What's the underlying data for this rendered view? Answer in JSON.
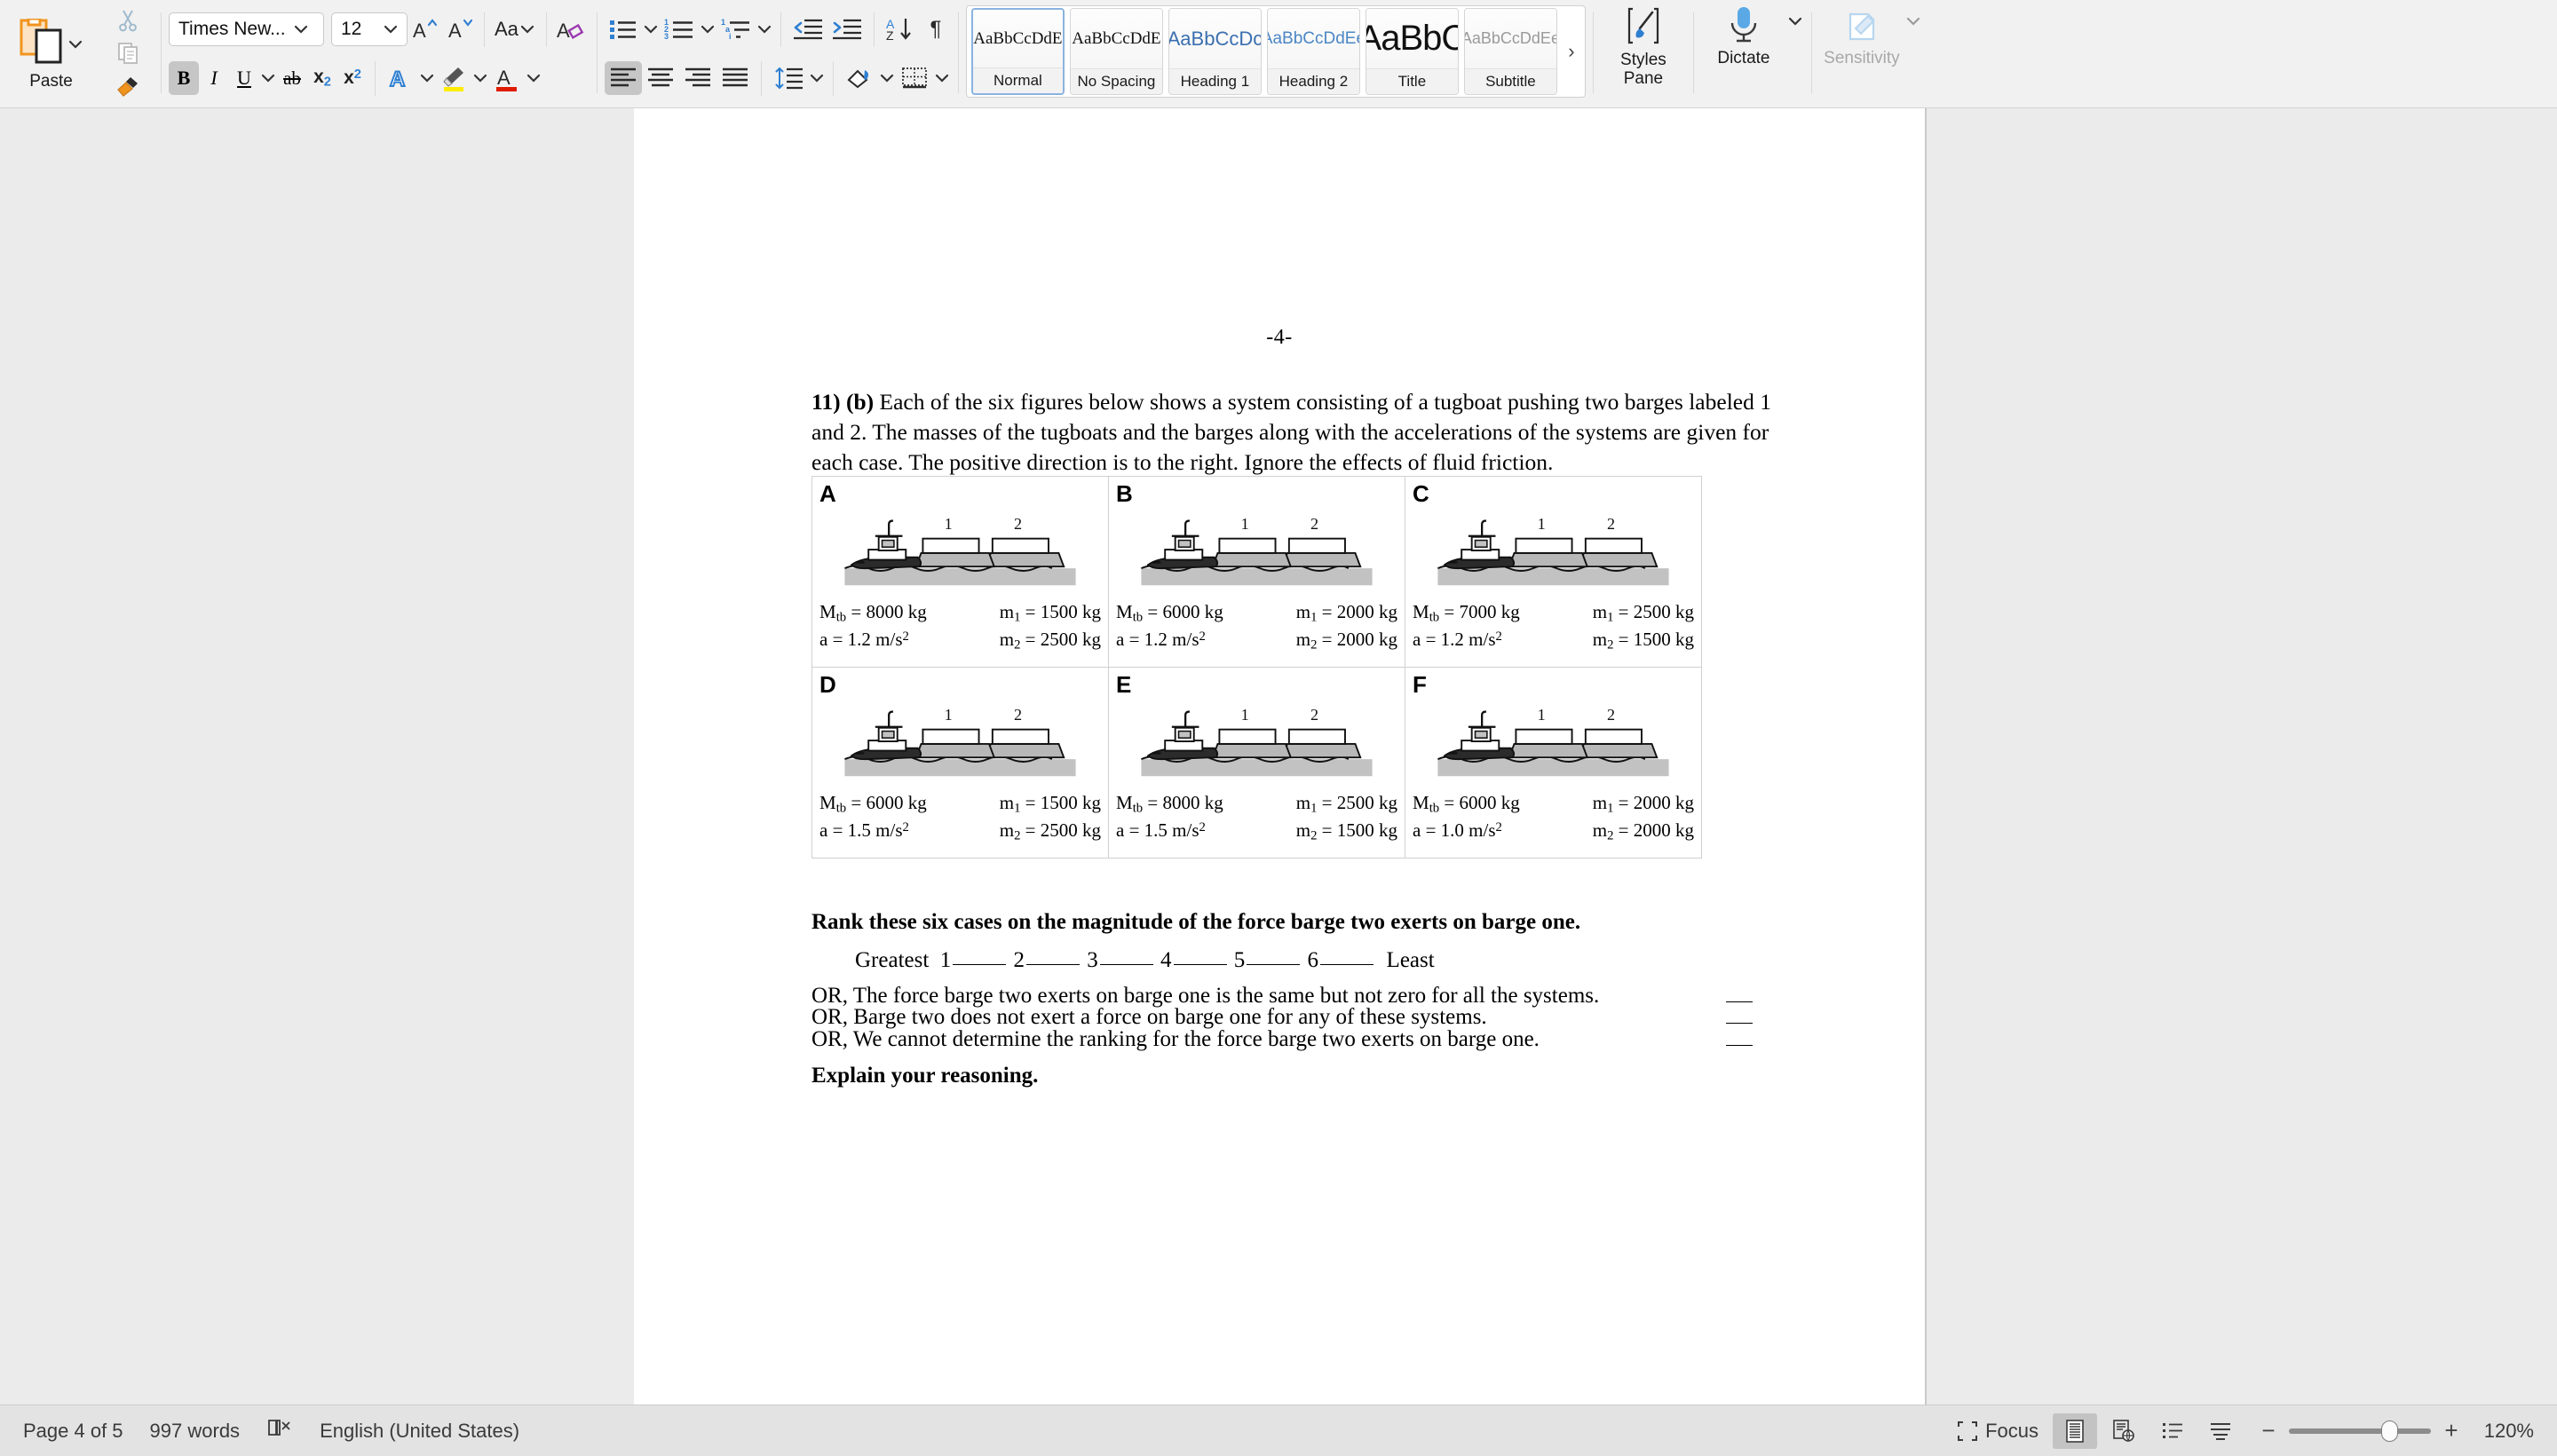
{
  "ribbon": {
    "paste": {
      "label": "Paste",
      "icon": "clipboard-icon"
    },
    "cut_icon": "scissors-icon",
    "copy_icon": "copy-icon",
    "format_painter_icon": "format-painter-icon",
    "font_name": "Times New...",
    "font_size": "12",
    "grow_font_icon": "grow-font-icon",
    "shrink_font_icon": "shrink-font-icon",
    "change_case_label": "Aa",
    "clear_formatting_icon": "clear-formatting-icon",
    "bold_label": "B",
    "italic_label": "I",
    "underline_label": "U",
    "strikethrough_label": "ab",
    "subscript_label": "x",
    "subscript_sub": "2",
    "superscript_label": "x",
    "superscript_sup": "2",
    "text_effects_label": "A",
    "highlight_label": "A",
    "font_color_label": "A",
    "bullets_icon": "bullet-list-icon",
    "numbering_icon": "numbered-list-icon",
    "multilevel_icon": "multilevel-list-icon",
    "decrease_indent_icon": "decrease-indent-icon",
    "increase_indent_icon": "increase-indent-icon",
    "sort_icon": "sort-az-icon",
    "show_marks_label": "¶",
    "align_left_icon": "align-left-icon",
    "align_center_icon": "align-center-icon",
    "align_right_icon": "align-right-icon",
    "justify_icon": "justify-icon",
    "line_spacing_icon": "line-spacing-icon",
    "shading_icon": "shading-icon",
    "borders_icon": "borders-icon",
    "styles": [
      {
        "preview": "AaBbCcDdE",
        "name": "Normal",
        "selected": true
      },
      {
        "preview": "AaBbCcDdE",
        "name": "No Spacing",
        "selected": false
      },
      {
        "preview": "AaBbCcDc",
        "name": "Heading 1",
        "selected": false
      },
      {
        "preview": "AaBbCcDdEe",
        "name": "Heading 2",
        "selected": false
      },
      {
        "preview": "AaBbC",
        "name": "Title",
        "selected": false
      },
      {
        "preview": "AaBbCcDdEe",
        "name": "Subtitle",
        "selected": false
      }
    ],
    "gallery_more": "›",
    "styles_pane_label": "Styles\nPane",
    "styles_pane_line1": "Styles",
    "styles_pane_line2": "Pane",
    "dictate_label": "Dictate",
    "sensitivity_label": "Sensitivity"
  },
  "document": {
    "page_number_header": "-4-",
    "question_number": "11) (b)",
    "question_text": " Each of the six figures below shows a system consisting of a tugboat pushing two barges labeled 1 and 2. The masses of the tugboats and the barges along with the accelerations of the systems are given for each case. The positive direction is to the right. Ignore the effects of fluid friction.",
    "barge_label_1": "1",
    "barge_label_2": "2",
    "cases": [
      {
        "letter": "A",
        "Mtb": "M<sub>tb</sub> = 8000 kg",
        "a": "a = 1.2 m/s<sup>2</sup>",
        "m1": "m<sub>1</sub> = 1500 kg",
        "m2": "m<sub>2</sub> = 2500 kg"
      },
      {
        "letter": "B",
        "Mtb": "M<sub>tb</sub> = 6000 kg",
        "a": "a = 1.2 m/s<sup>2</sup>",
        "m1": "m<sub>1</sub> = 2000 kg",
        "m2": "m<sub>2</sub> = 2000 kg"
      },
      {
        "letter": "C",
        "Mtb": "M<sub>tb</sub> = 7000 kg",
        "a": "a = 1.2 m/s<sup>2</sup>",
        "m1": "m<sub>1</sub> = 2500 kg",
        "m2": "m<sub>2</sub> = 1500 kg"
      },
      {
        "letter": "D",
        "Mtb": "M<sub>tb</sub> = 6000 kg",
        "a": "a = 1.5 m/s<sup>2</sup>",
        "m1": "m<sub>1</sub> = 1500 kg",
        "m2": "m<sub>2</sub> = 2500 kg"
      },
      {
        "letter": "E",
        "Mtb": "M<sub>tb</sub> = 8000 kg",
        "a": "a = 1.5 m/s<sup>2</sup>",
        "m1": "m<sub>1</sub> = 2500 kg",
        "m2": "m<sub>2</sub> = 1500 kg"
      },
      {
        "letter": "F",
        "Mtb": "M<sub>tb</sub> = 6000 kg",
        "a": "a = 1.0 m/s<sup>2</sup>",
        "m1": "m<sub>1</sub> = 2000 kg",
        "m2": "m<sub>2</sub> = 2000 kg"
      }
    ],
    "rank_prompt": "Rank these six cases on the magnitude of the force barge two exerts on barge one.",
    "rank_greatest": "Greatest",
    "rank_least": "Least",
    "rank_numbers": [
      "1",
      "2",
      "3",
      "4",
      "5",
      "6"
    ],
    "or_options": [
      "OR, The force barge two exerts on barge one is the same but not zero for all the systems.",
      "OR, Barge two does not exert a force on barge one for any of these systems.",
      "OR, We cannot determine the ranking for the force barge two exerts on barge one."
    ],
    "explain": "Explain your reasoning."
  },
  "statusbar": {
    "page_count": "Page 4 of 5",
    "word_count": "997 words",
    "proofing_icon": "proofing-errors-icon",
    "language": "English (United States)",
    "focus_label": "Focus",
    "print_layout_icon": "print-layout-icon",
    "web_layout_icon": "web-layout-icon",
    "outline_icon": "outline-view-icon",
    "draft_icon": "draft-view-icon",
    "zoom_out": "−",
    "zoom_in": "+",
    "zoom_level": "120%"
  },
  "colors": {
    "accent_blue": "#2f7fd1",
    "highlight_yellow": "#ffec00",
    "font_red": "#e01b00",
    "paste_orange": "#f0941e",
    "ribbon_bg": "#f1f1f1",
    "canvas_bg": "#ebebeb",
    "status_bg": "#e3e3e3"
  }
}
